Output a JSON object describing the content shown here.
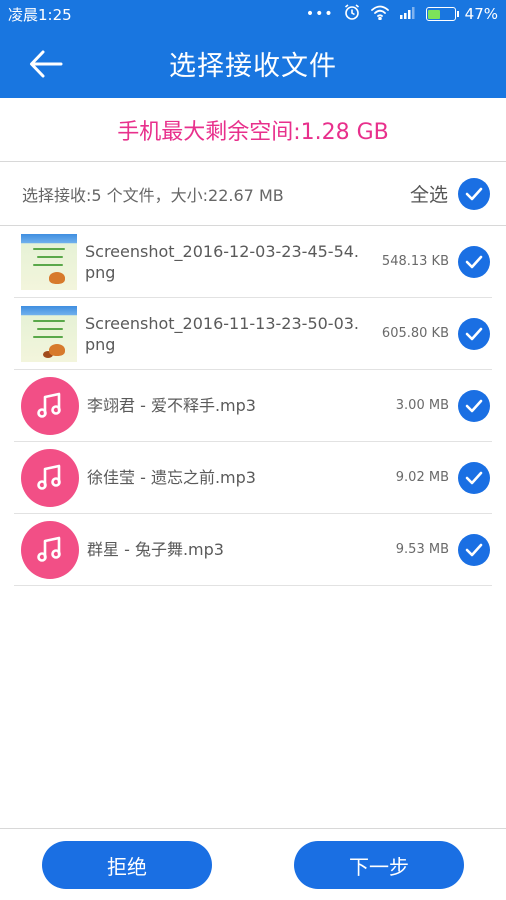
{
  "status_bar": {
    "time": "凌晨1:25",
    "dots": "•••",
    "battery": "47%",
    "battery_level": 0.47,
    "icons": [
      "alarm-icon",
      "wifi-icon",
      "signal-icon",
      "battery-icon"
    ]
  },
  "header": {
    "title": "选择接收文件",
    "back_icon": "back-arrow-icon"
  },
  "storage": {
    "text": "手机最大剩余空间:1.28 GB"
  },
  "summary": {
    "text": "选择接收:5 个文件，大小:22.67 MB",
    "select_all_label": "全选"
  },
  "files": [
    {
      "name": "Screenshot_2016-12-03-23-45-54.png",
      "size": "548.13 KB",
      "type": "image",
      "checked": true
    },
    {
      "name": "Screenshot_2016-11-13-23-50-03.png",
      "size": "605.80 KB",
      "type": "image",
      "checked": true
    },
    {
      "name": "李翊君 - 爱不释手.mp3",
      "size": "3.00 MB",
      "type": "music",
      "checked": true
    },
    {
      "name": "徐佳莹 - 遗忘之前.mp3",
      "size": "9.02 MB",
      "type": "music",
      "checked": true
    },
    {
      "name": "群星 - 兔子舞.mp3",
      "size": "9.53 MB",
      "type": "music",
      "checked": true
    }
  ],
  "actions": {
    "reject_label": "拒绝",
    "next_label": "下一步"
  },
  "colors": {
    "primary": "#1976e0",
    "storage_text": "#e8308c",
    "music_avatar": "#f24f86",
    "check": "#1a6fe3"
  }
}
